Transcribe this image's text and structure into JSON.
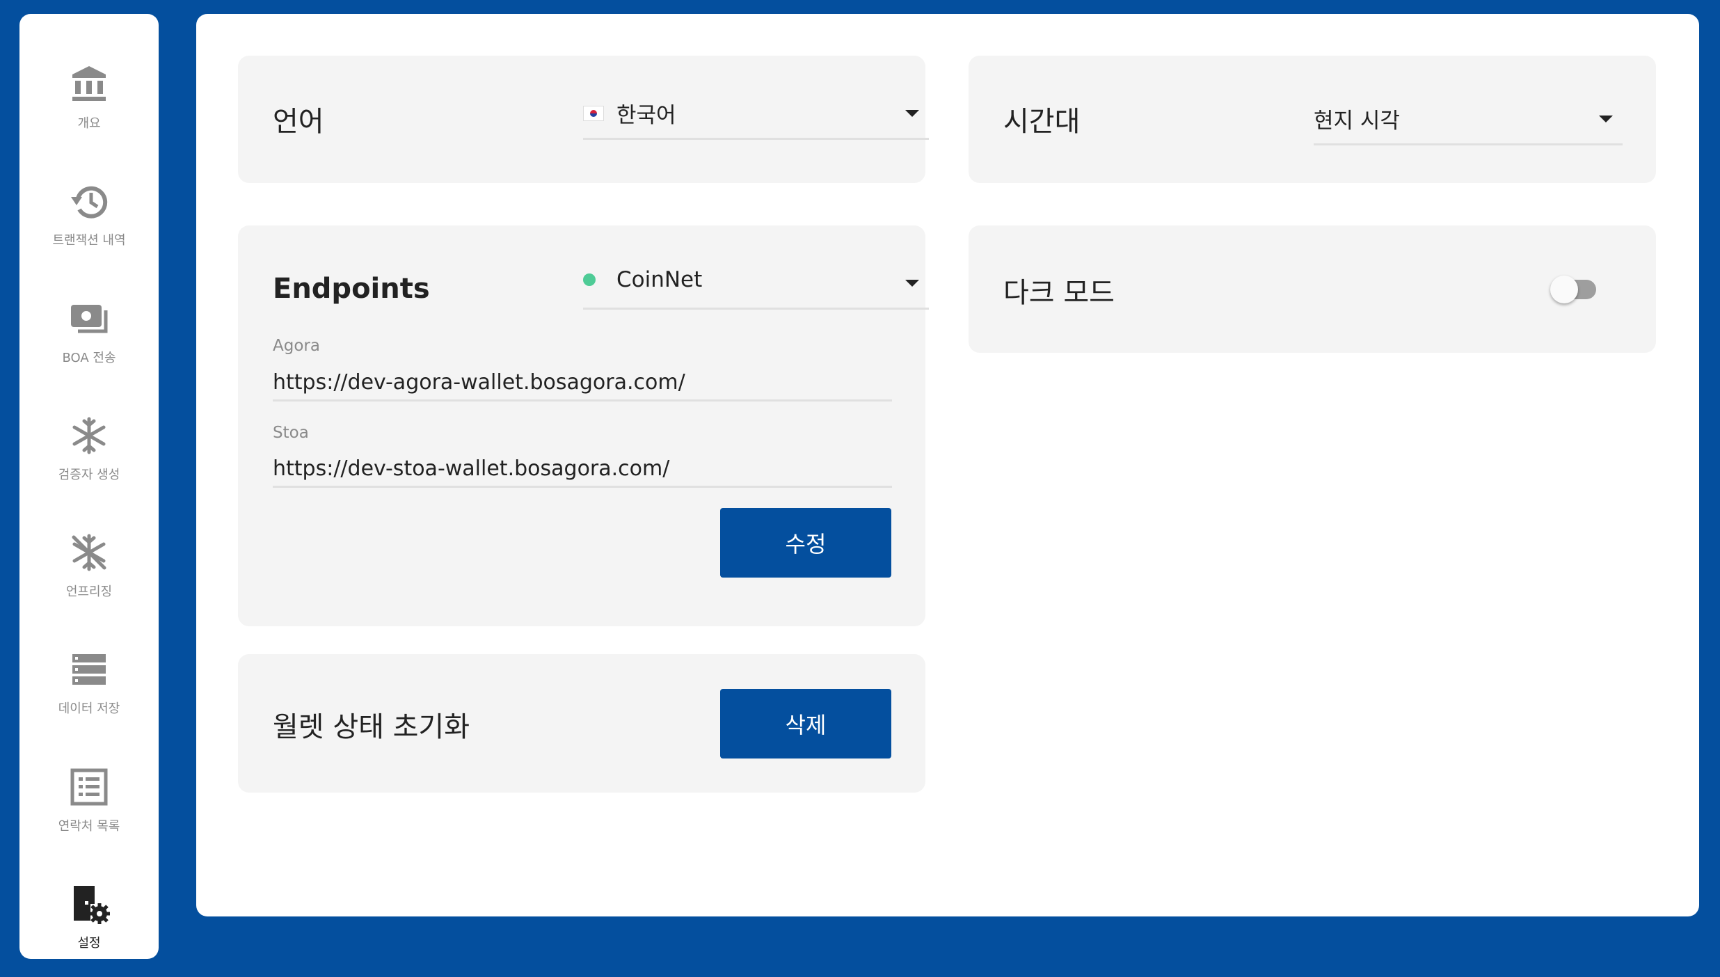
{
  "sidebar": {
    "items": [
      {
        "label": "개요",
        "icon": "bank-icon"
      },
      {
        "label": "트랜잭션 내역",
        "icon": "history-icon"
      },
      {
        "label": "BOA 전송",
        "icon": "send-money-icon"
      },
      {
        "label": "검증자 생성",
        "icon": "snowflake-icon"
      },
      {
        "label": "언프리징",
        "icon": "unfreeze-icon"
      },
      {
        "label": "데이터 저장",
        "icon": "storage-icon"
      },
      {
        "label": "연락처 목록",
        "icon": "contact-list-icon"
      },
      {
        "label": "설정",
        "icon": "settings-door-icon"
      }
    ],
    "active_index": 7
  },
  "language": {
    "title": "언어",
    "selected": "한국어",
    "flag_icon": "korea-flag-icon"
  },
  "timezone": {
    "title": "시간대",
    "selected": "현지 시각"
  },
  "endpoints": {
    "title": "Endpoints",
    "network": "CoinNet",
    "network_status_color": "#4ecb96",
    "agora_label": "Agora",
    "agora_value": "https://dev-agora-wallet.bosagora.com/",
    "stoa_label": "Stoa",
    "stoa_value": "https://dev-stoa-wallet.bosagora.com/",
    "edit_button": "수정"
  },
  "dark_mode": {
    "title": "다크 모드",
    "enabled": false
  },
  "reset": {
    "title": "월렛 상태 초기화",
    "delete_button": "삭제"
  },
  "colors": {
    "brand": "#044f9e",
    "card_bg": "#f4f4f4"
  }
}
